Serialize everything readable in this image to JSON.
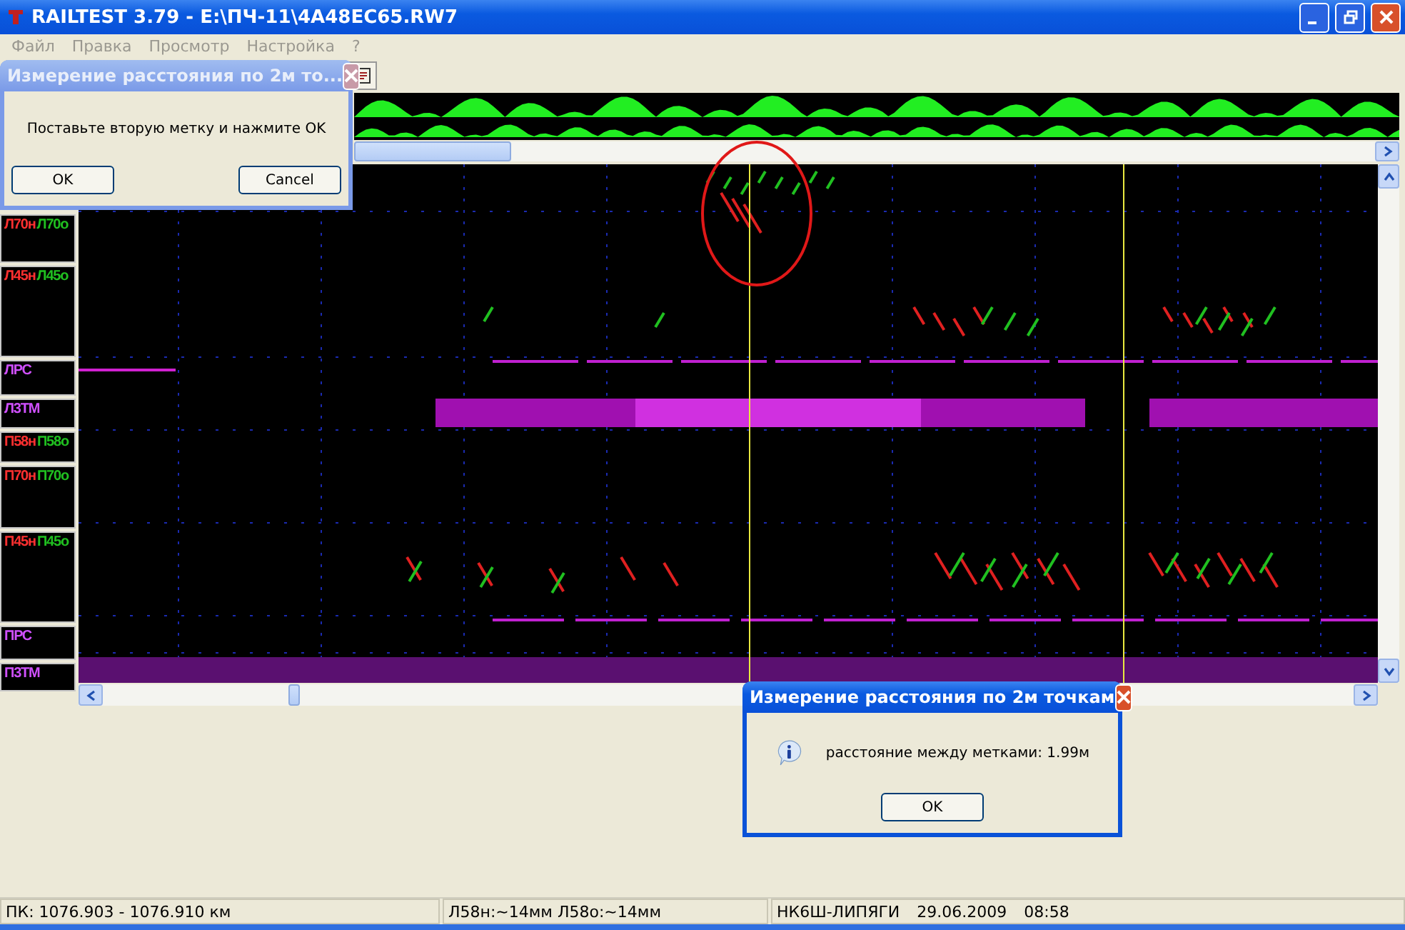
{
  "window": {
    "title": "RAILTEST 3.79 - E:\\ПЧ-11\\4A48EC65.RW7"
  },
  "menu": [
    {
      "label": "Файл",
      "disabled": true
    },
    {
      "label": "Правка",
      "disabled": true
    },
    {
      "label": "Просмотр",
      "disabled": true
    },
    {
      "label": "Настройка",
      "disabled": true
    },
    {
      "label": "?",
      "disabled": true
    }
  ],
  "channels": [
    {
      "labels": [
        {
          "text": "Л70н",
          "color": "#ff3030"
        },
        {
          "text": "Л70о",
          "color": "#20c020"
        }
      ]
    },
    {
      "labels": [
        {
          "text": "Л45н",
          "color": "#ff3030"
        },
        {
          "text": "Л45о",
          "color": "#20c020"
        }
      ]
    },
    {
      "labels": [
        {
          "text": "ЛРС",
          "color": "#d050ff"
        }
      ]
    },
    {
      "labels": [
        {
          "text": "Л3ТМ",
          "color": "#d050ff"
        }
      ]
    },
    {
      "labels": [
        {
          "text": "П58н",
          "color": "#ff3030"
        },
        {
          "text": "П58о",
          "color": "#20c020"
        }
      ]
    },
    {
      "labels": [
        {
          "text": "П70н",
          "color": "#ff3030"
        },
        {
          "text": "П70о",
          "color": "#20c020"
        }
      ]
    },
    {
      "labels": [
        {
          "text": "П45н",
          "color": "#ff3030"
        },
        {
          "text": "П45о",
          "color": "#20c020"
        }
      ]
    },
    {
      "labels": [
        {
          "text": "ПРС",
          "color": "#d050ff"
        }
      ]
    },
    {
      "labels": [
        {
          "text": "П3ТМ",
          "color": "#d050ff"
        }
      ]
    }
  ],
  "status_bar": [
    "ПК: 1076.903 - 1076.910 км",
    "Л58н:~14мм Л58о:~14мм",
    "НК6Ш-ЛИПЯГИ",
    "29.06.2009",
    "08:58"
  ],
  "dialogs": [
    {
      "kind": "prompt",
      "active": false,
      "title": "Измерение расстояния по 2м то...",
      "message": "Поставьте вторую метку и нажмите OK",
      "buttons": [
        "OK",
        "Cancel"
      ]
    },
    {
      "kind": "info",
      "active": true,
      "title": "Измерение расстояния по 2м точкам",
      "message": "расстояние между метками: 1.99м",
      "buttons": [
        "OK"
      ]
    }
  ]
}
